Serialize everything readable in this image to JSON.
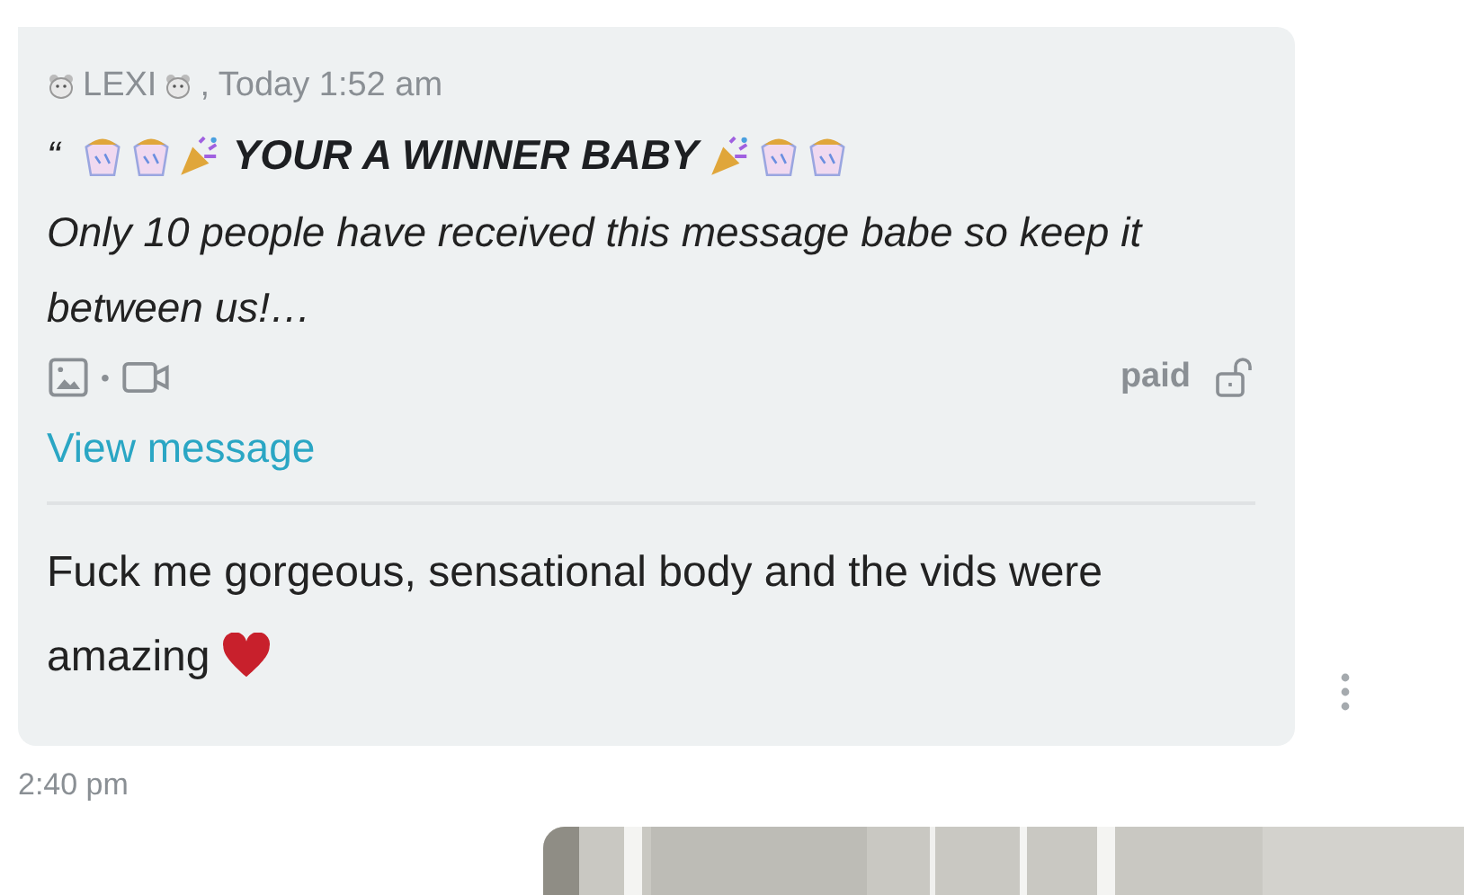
{
  "message": {
    "sender": "LEXI",
    "sent_time": ", Today 1:52 am",
    "quote_mark": "“",
    "title": "YOUR A WINNER BABY",
    "preview": "Only 10 people have received this message babe so keep it between us!…",
    "media_separator": "•",
    "price_label": "paid",
    "link": "View message",
    "reply": "Fuck me gorgeous, sensational body and the vids were amazing",
    "time": "2:40 pm"
  }
}
